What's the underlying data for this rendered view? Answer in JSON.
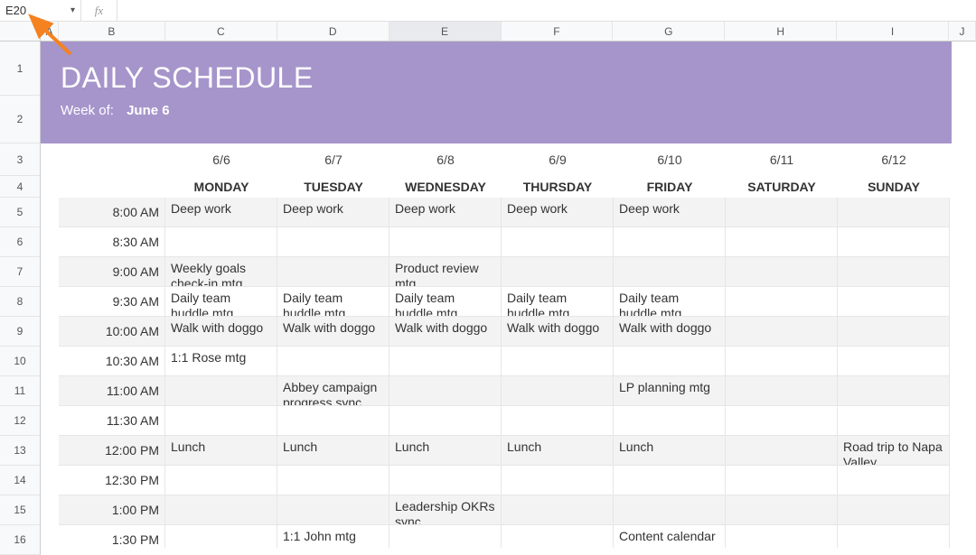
{
  "formula_bar": {
    "name_box": "E20",
    "fx_label": "fx",
    "formula_value": ""
  },
  "columns": [
    "A",
    "B",
    "C",
    "D",
    "E",
    "F",
    "G",
    "H",
    "I",
    "J"
  ],
  "selected_column": "E",
  "row_numbers": [
    "1",
    "2",
    "3",
    "4",
    "5",
    "6",
    "7",
    "8",
    "9",
    "10",
    "11",
    "12",
    "13",
    "14",
    "15",
    "16"
  ],
  "row_heights": {
    "1": 60,
    "2": 53,
    "3": 36,
    "4": 24
  },
  "banner": {
    "title": "DAILY SCHEDULE",
    "week_label": "Week of:",
    "week_value": "June 6"
  },
  "dates": [
    "6/6",
    "6/7",
    "6/8",
    "6/9",
    "6/10",
    "6/11",
    "6/12"
  ],
  "days": [
    "MONDAY",
    "TUESDAY",
    "WEDNESDAY",
    "THURSDAY",
    "FRIDAY",
    "SATURDAY",
    "SUNDAY"
  ],
  "times": [
    "8:00 AM",
    "8:30 AM",
    "9:00 AM",
    "9:30 AM",
    "10:00 AM",
    "10:30 AM",
    "11:00 AM",
    "11:30 AM",
    "12:00 PM",
    "12:30 PM",
    "1:00 PM",
    "1:30 PM"
  ],
  "grid": [
    [
      "Deep work",
      "Deep work",
      "Deep work",
      "Deep work",
      "Deep work",
      "",
      ""
    ],
    [
      "",
      "",
      "",
      "",
      "",
      "",
      ""
    ],
    [
      "Weekly goals check-in mtg",
      "",
      "Product review mtg",
      "",
      "",
      "",
      ""
    ],
    [
      "Daily team huddle mtg",
      "Daily team huddle mtg",
      "Daily team huddle mtg",
      "Daily team huddle mtg",
      "Daily team huddle mtg",
      "",
      ""
    ],
    [
      "Walk with doggo",
      "Walk with doggo",
      "Walk with doggo",
      "Walk with doggo",
      "Walk with doggo",
      "",
      ""
    ],
    [
      "1:1 Rose mtg",
      "",
      "",
      "",
      "",
      "",
      ""
    ],
    [
      "",
      "Abbey campaign progress sync mtg",
      "",
      "",
      "LP planning mtg",
      "",
      ""
    ],
    [
      "",
      "",
      "",
      "",
      "",
      "",
      ""
    ],
    [
      "Lunch",
      "Lunch",
      "Lunch",
      "Lunch",
      "Lunch",
      "",
      "Road trip to Napa Valley"
    ],
    [
      "",
      "",
      "",
      "",
      "",
      "",
      ""
    ],
    [
      "",
      "",
      "Leadership OKRs sync",
      "",
      "",
      "",
      ""
    ],
    [
      "",
      "1:1 John mtg",
      "",
      "",
      "Content calendar",
      "",
      ""
    ]
  ],
  "annotation": {
    "type": "arrow",
    "color": "#f58220",
    "points_to": "name-box"
  }
}
